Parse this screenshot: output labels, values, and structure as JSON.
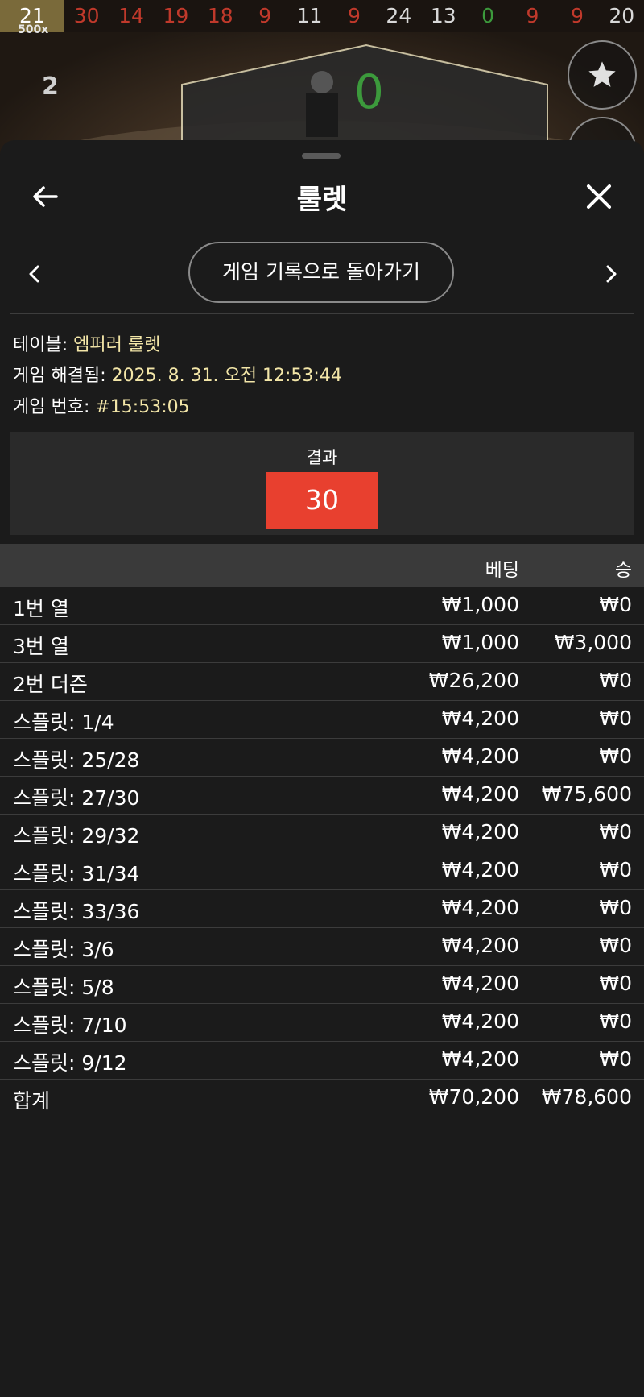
{
  "history": {
    "multiplier": "500x",
    "numbers": [
      {
        "value": "21",
        "color": "first"
      },
      {
        "value": "30",
        "color": "red"
      },
      {
        "value": "14",
        "color": "red"
      },
      {
        "value": "19",
        "color": "red"
      },
      {
        "value": "18",
        "color": "red"
      },
      {
        "value": "9",
        "color": "red"
      },
      {
        "value": "11",
        "color": "black"
      },
      {
        "value": "9",
        "color": "red"
      },
      {
        "value": "24",
        "color": "black"
      },
      {
        "value": "13",
        "color": "black"
      },
      {
        "value": "0",
        "color": "green"
      },
      {
        "value": "9",
        "color": "red"
      },
      {
        "value": "9",
        "color": "red"
      },
      {
        "value": "20",
        "color": "black"
      }
    ]
  },
  "game": {
    "side_count": "2",
    "result_preview": "0"
  },
  "panel": {
    "title": "룰렛",
    "back_history_label": "게임 기록으로 돌아가기"
  },
  "info": {
    "table_label": "테이블:",
    "table_value": "엠퍼러 룰렛",
    "resolved_label": "게임 해결됨:",
    "resolved_value": "2025. 8. 31. 오전 12:53:44",
    "number_label": "게임 번호:",
    "number_value": "#15:53:05"
  },
  "result": {
    "label": "결과",
    "value": "30",
    "color": "#e8402f"
  },
  "bets": {
    "header": {
      "bet": "베팅",
      "win": "승"
    },
    "rows": [
      {
        "name": "1번 열",
        "bet": "₩1,000",
        "win": "₩0"
      },
      {
        "name": "3번 열",
        "bet": "₩1,000",
        "win": "₩3,000"
      },
      {
        "name": "2번 더즌",
        "bet": "₩26,200",
        "win": "₩0"
      },
      {
        "name": "스플릿: 1/4",
        "bet": "₩4,200",
        "win": "₩0"
      },
      {
        "name": "스플릿: 25/28",
        "bet": "₩4,200",
        "win": "₩0"
      },
      {
        "name": "스플릿: 27/30",
        "bet": "₩4,200",
        "win": "₩75,600"
      },
      {
        "name": "스플릿: 29/32",
        "bet": "₩4,200",
        "win": "₩0"
      },
      {
        "name": "스플릿: 31/34",
        "bet": "₩4,200",
        "win": "₩0"
      },
      {
        "name": "스플릿: 33/36",
        "bet": "₩4,200",
        "win": "₩0"
      },
      {
        "name": "스플릿: 3/6",
        "bet": "₩4,200",
        "win": "₩0"
      },
      {
        "name": "스플릿: 5/8",
        "bet": "₩4,200",
        "win": "₩0"
      },
      {
        "name": "스플릿: 7/10",
        "bet": "₩4,200",
        "win": "₩0"
      },
      {
        "name": "스플릿: 9/12",
        "bet": "₩4,200",
        "win": "₩0"
      }
    ],
    "total": {
      "name": "합계",
      "bet": "₩70,200",
      "win": "₩78,600"
    }
  },
  "icons": {
    "back": "arrow-left-icon",
    "close": "close-icon",
    "prev": "chevron-left-icon",
    "next": "chevron-right-icon",
    "favorite": "star-icon"
  }
}
